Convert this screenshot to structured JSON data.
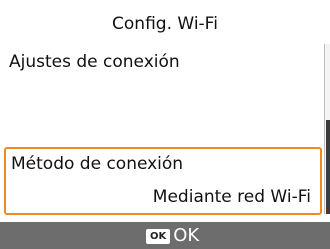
{
  "screen": {
    "title": "Config. Wi-Fi"
  },
  "menu": {
    "items": [
      {
        "label": "Ajustes de conexión",
        "value": ""
      },
      {
        "label": "Método de conexión",
        "value": "Mediante red Wi-Fi"
      }
    ],
    "selected_index": 1
  },
  "footer": {
    "ok_key": "OK",
    "ok_label": "OK"
  },
  "colors": {
    "selection_border": "#f08a1e",
    "footer_background": "#6d6d6d",
    "text": "#111111"
  },
  "icons": {
    "ok_key": "ok-button-icon"
  }
}
